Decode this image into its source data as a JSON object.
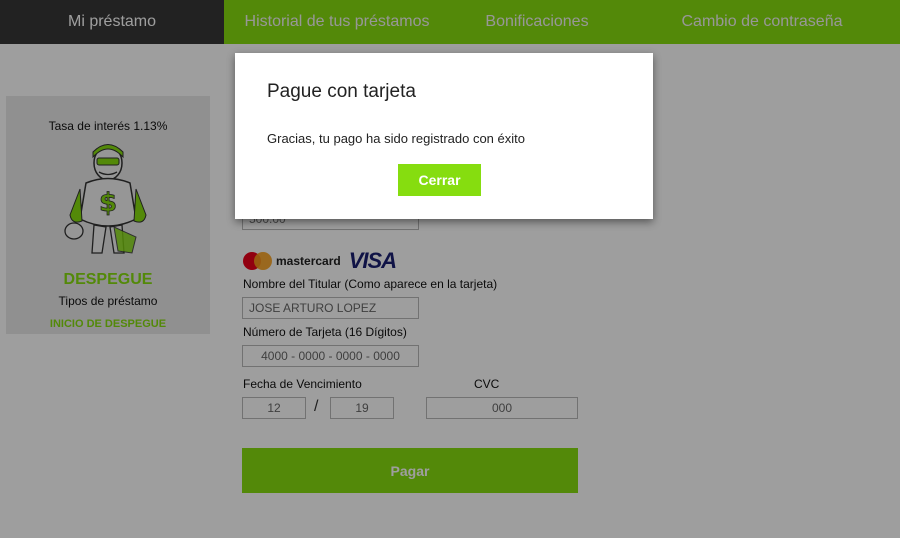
{
  "nav": {
    "tabs": [
      {
        "label": "Mi préstamo",
        "active": true
      },
      {
        "label": "Historial de tus préstamos",
        "active": false
      },
      {
        "label": "Bonificaciones",
        "active": false
      },
      {
        "label": "Cambio de contraseña",
        "active": false
      }
    ]
  },
  "promo": {
    "rate": "Tasa de interés 1.13%",
    "brand": "DESPEGUE",
    "subtitle": "Tipos de préstamo",
    "link": "INICIO DE DESPEGUE"
  },
  "payment": {
    "amount_value": "500.00",
    "card_logos": {
      "mastercard": "mastercard",
      "visa": "VISA"
    },
    "holder_label": "Nombre del Titular (Como aparece en la tarjeta)",
    "holder_value": "JOSE ARTURO LOPEZ",
    "card_number_label": "Número de Tarjeta (16 Dígitos)",
    "card_number_value": "4000 - 0000 - 0000 - 0000",
    "expiry_label": "Fecha de Vencimiento",
    "expiry_month": "12",
    "expiry_separator": "/",
    "expiry_year": "19",
    "cvc_label": "CVC",
    "cvc_value": "000",
    "pay_button": "Pagar"
  },
  "modal": {
    "title": "Pague con tarjeta",
    "message": "Gracias, tu pago ha sido registrado con éxito",
    "close_button": "Cerrar"
  },
  "colors": {
    "accent_green": "#86dd0f",
    "nav_active": "#383838",
    "overlay": "rgba(0,0,0,0.38)"
  }
}
